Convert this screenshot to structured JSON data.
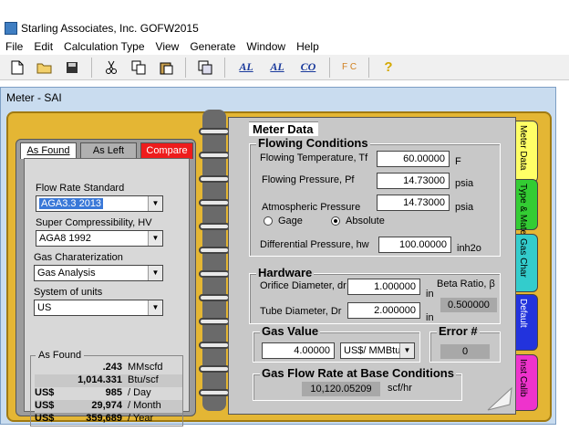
{
  "app": {
    "title": "Starling Associates, Inc. GOFW2015"
  },
  "menu": [
    {
      "label": "File",
      "mnemonic": "F"
    },
    {
      "label": "Edit",
      "mnemonic": "E"
    },
    {
      "label": "Calculation Type",
      "mnemonic": "C"
    },
    {
      "label": "View",
      "mnemonic": "V"
    },
    {
      "label": "Generate",
      "mnemonic": "G"
    },
    {
      "label": "Window",
      "mnemonic": "W"
    },
    {
      "label": "Help",
      "mnemonic": "H"
    }
  ],
  "toolbar": {
    "icons": [
      "new-file-icon",
      "open-folder-icon",
      "save-icon",
      "cut-icon",
      "copy-icon",
      "paste-icon",
      "window-icon",
      "alc-a-icon",
      "alc-b-icon",
      "alc-c-icon",
      "fc-icon",
      "help-icon"
    ],
    "alc_a": "AL",
    "alc_b": "AL",
    "alc_c": "CO",
    "fc": "F C",
    "help": "?"
  },
  "child": {
    "title": "Meter - SAI"
  },
  "left": {
    "tabs": {
      "as_found": "As Found",
      "as_left": "As Left",
      "compare": "Compare"
    },
    "flow_rate_standard": {
      "label": "Flow Rate Standard",
      "value": "AGA3.3 2013"
    },
    "super_compressibility": {
      "label": "Super Compressibility, HV",
      "value": "AGA8 1992"
    },
    "gas_characterization": {
      "label": "Gas Charaterization",
      "value": "Gas Analysis"
    },
    "system_of_units": {
      "label": "System of units",
      "value": "US"
    },
    "as_found_box": {
      "title": "As Found",
      "rows": [
        {
          "currency": "",
          "value": ".243",
          "unit": "MMscfd"
        },
        {
          "currency": "",
          "value": "1,014.331",
          "unit": "Btu/scf"
        },
        {
          "currency": "US$",
          "value": "985",
          "unit": "/  Day"
        },
        {
          "currency": "US$",
          "value": "29,974",
          "unit": "/  Month"
        },
        {
          "currency": "US$",
          "value": "359,689",
          "unit": "/  Year"
        }
      ]
    }
  },
  "meter": {
    "title": "Meter Data",
    "flowing": {
      "title": "Flowing Conditions",
      "temp_label": "Flowing Temperature, Tf",
      "temp_value": "60.00000",
      "temp_unit": "F",
      "press_label": "Flowing Pressure, Pf",
      "press_value": "14.73000",
      "press_unit": "psia",
      "atm_label": "Atmospheric Pressure",
      "atm_value": "14.73000",
      "atm_unit": "psia",
      "gauge_label": "Gage",
      "absolute_label": "Absolute",
      "diff_label": "Differential Pressure, hw",
      "diff_value": "100.00000",
      "diff_unit": "inh2o"
    },
    "hardware": {
      "title": "Hardware",
      "orifice_label": "Orifice Diameter, dr",
      "orifice_value": "1.000000",
      "orifice_unit": "in",
      "tube_label": "Tube Diameter, Dr",
      "tube_value": "2.000000",
      "tube_unit": "in",
      "beta_label": "Beta Ratio, β",
      "beta_value": "0.500000"
    },
    "gas_value": {
      "title": "Gas Value",
      "value": "4.00000",
      "unit": "US$/ MMBtu"
    },
    "error": {
      "title": "Error #",
      "value": "0"
    },
    "flow_rate": {
      "title": "Gas Flow Rate at Base Conditions",
      "value": "10,120.05209",
      "unit": "scf/hr"
    }
  },
  "side_tabs": [
    {
      "label": "Meter Data",
      "color": "#ffff66"
    },
    {
      "label": "Type & Materials",
      "color": "#33cc33"
    },
    {
      "label": "Gas Char",
      "color": "#33cccc"
    },
    {
      "label": "Default",
      "color": "#2233dd"
    },
    {
      "label": "Inst Calib",
      "color": "#ee33cc"
    }
  ]
}
